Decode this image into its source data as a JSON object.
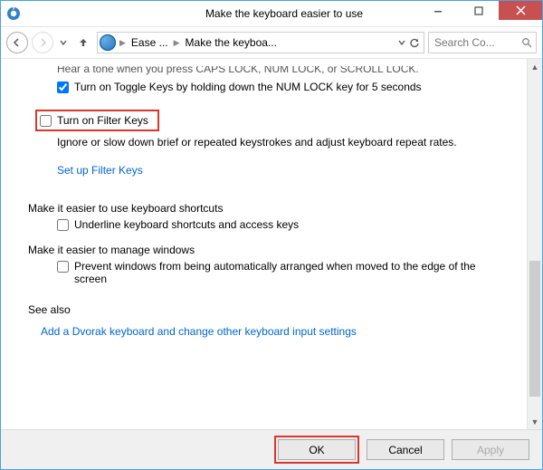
{
  "titlebar": {
    "title": "Make the keyboard easier to use"
  },
  "nav": {
    "crumb1": "Ease ...",
    "crumb2": "Make the keyboa..."
  },
  "search": {
    "placeholder": "Search Co..."
  },
  "content": {
    "truncated_line": "Hear a tone when you press CAPS LOCK, NUM LOCK, or SCROLL LOCK.",
    "toggle_keys_label": "Turn on Toggle Keys by holding down the NUM LOCK key for 5 seconds",
    "filter_keys_label": "Turn on Filter Keys",
    "filter_keys_desc": "Ignore or slow down brief or repeated keystrokes and adjust keyboard repeat rates.",
    "filter_keys_link": "Set up Filter Keys",
    "section_shortcuts": "Make it easier to use keyboard shortcuts",
    "underline_label": "Underline keyboard shortcuts and access keys",
    "section_windows": "Make it easier to manage windows",
    "prevent_label": "Prevent windows from being automatically arranged when moved to the edge of the screen",
    "see_also": "See also",
    "dvorak_link": "Add a Dvorak keyboard and change other keyboard input settings"
  },
  "footer": {
    "ok": "OK",
    "cancel": "Cancel",
    "apply": "Apply"
  },
  "checks": {
    "toggle_keys": true,
    "filter_keys": false,
    "underline": false,
    "prevent": false
  }
}
